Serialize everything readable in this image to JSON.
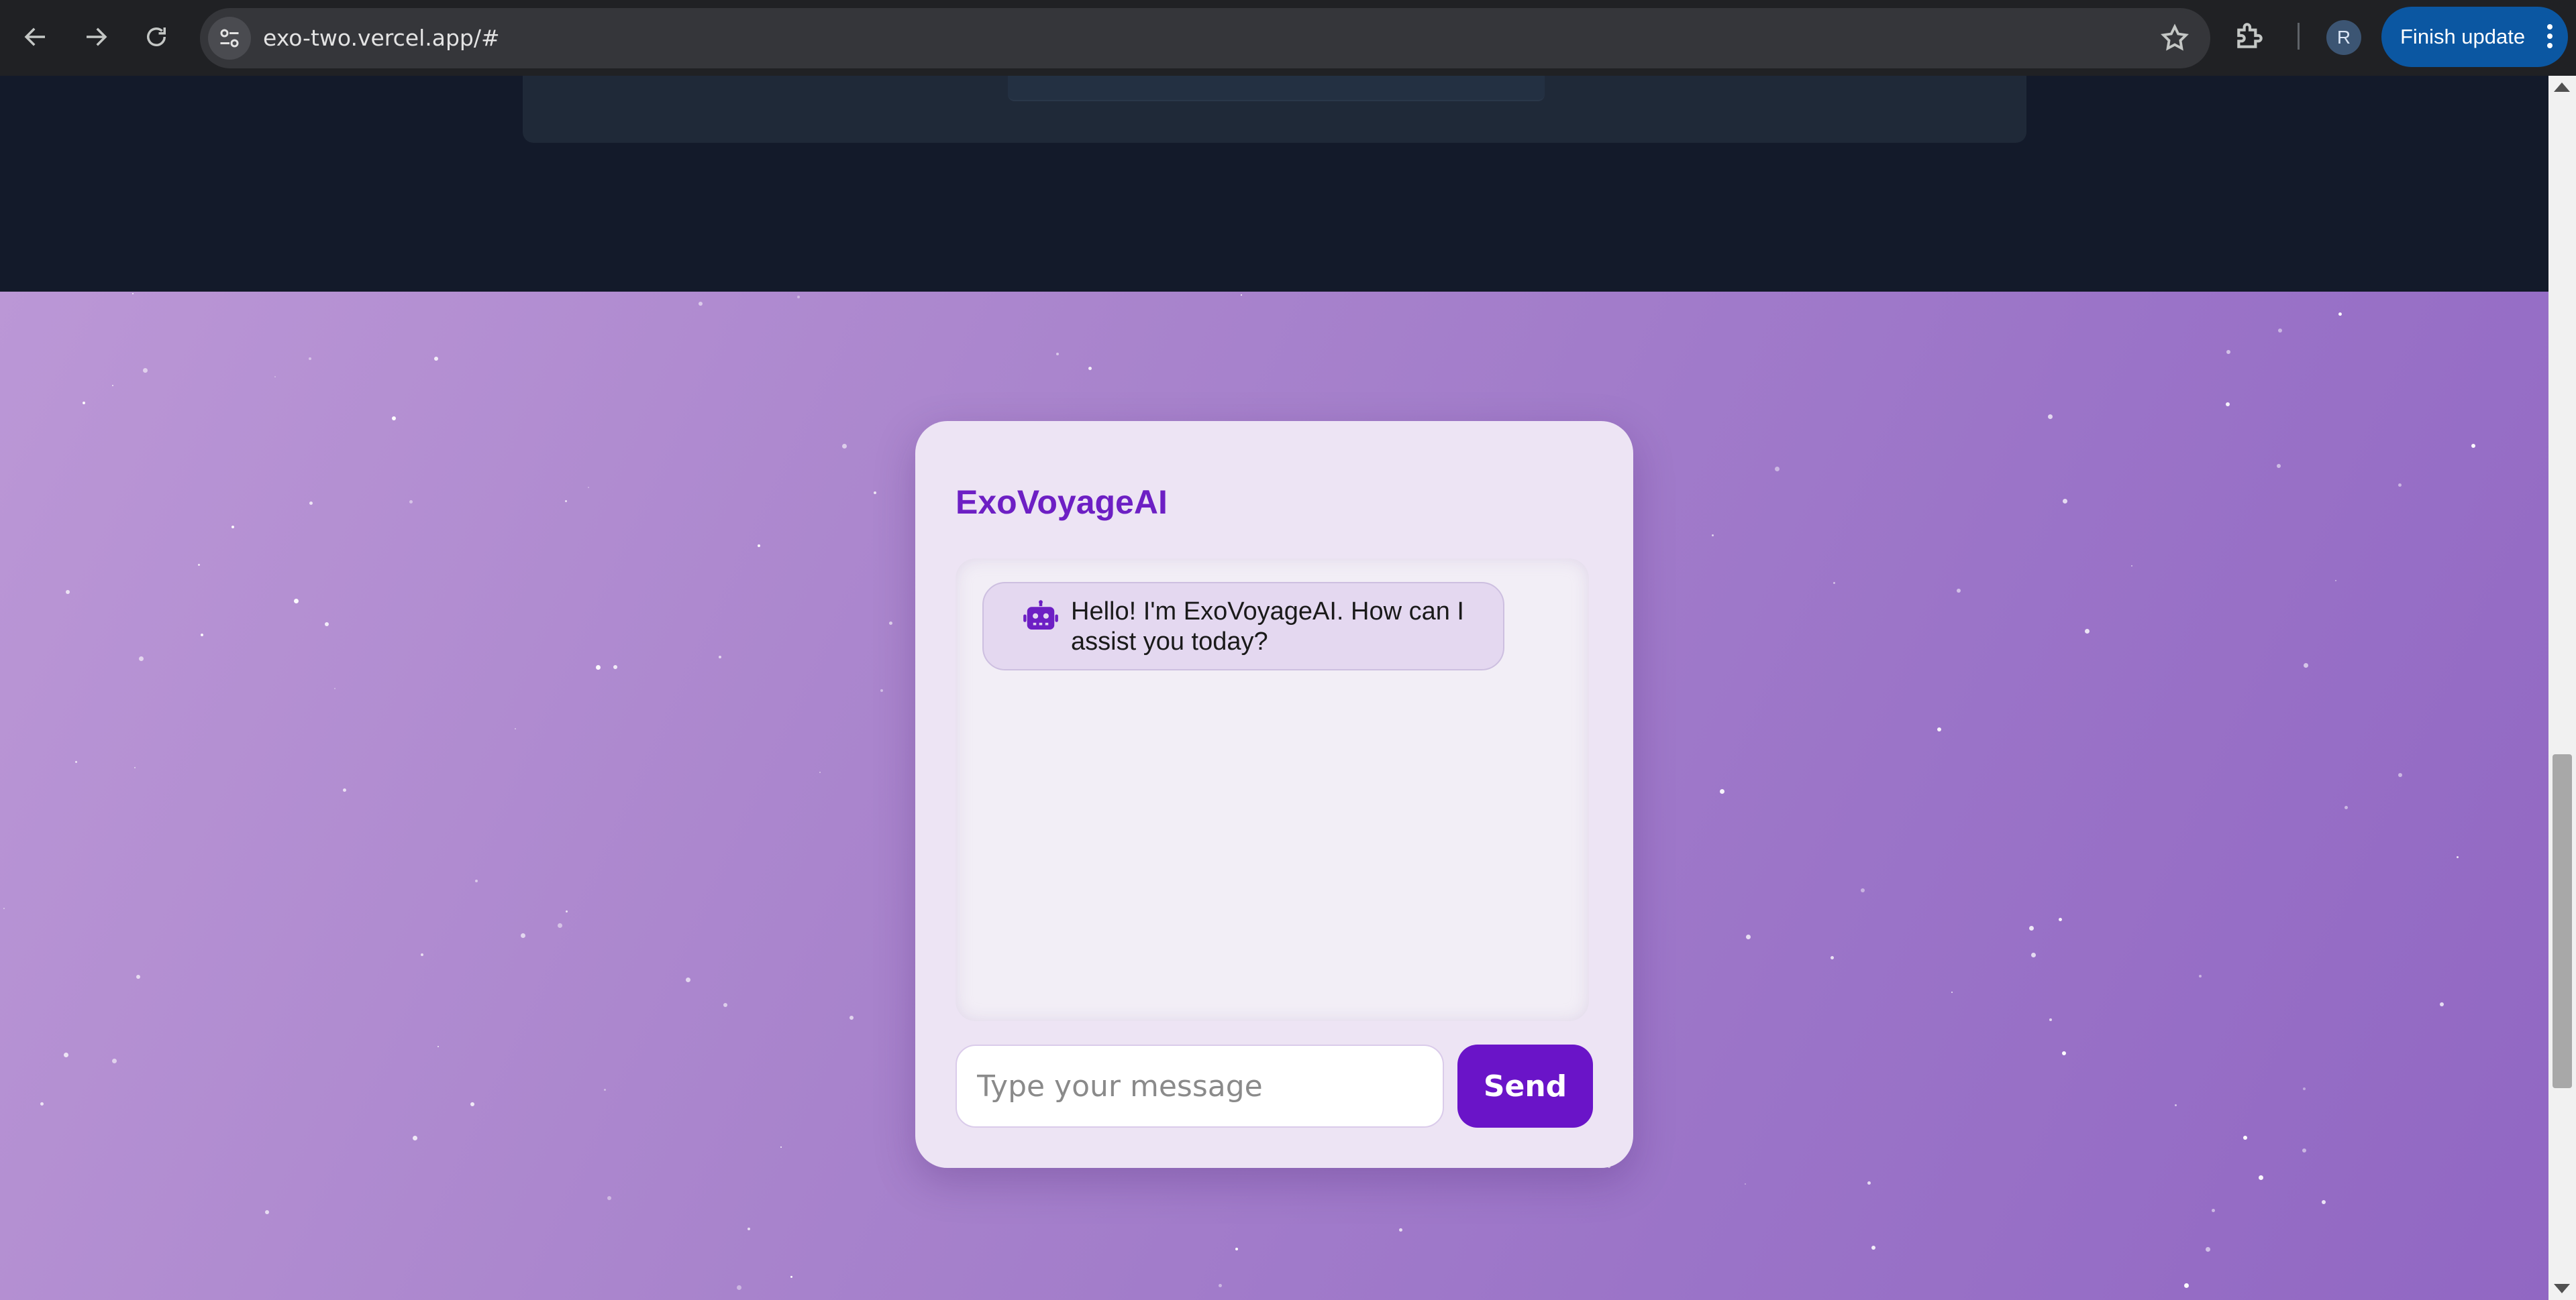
{
  "browser": {
    "url": "exo-two.vercel.app/#",
    "profile_initial": "R",
    "finish_update_label": "Finish update"
  },
  "chat": {
    "title": "ExoVoyageAI",
    "messages": [
      {
        "sender": "bot",
        "icon": "robot-icon",
        "text": "Hello! I'm ExoVoyageAI. How can I assist you today?"
      }
    ],
    "input": {
      "placeholder": "Type your message",
      "value": ""
    },
    "send_label": "Send"
  },
  "colors": {
    "accent": "#6a14c8",
    "title": "#6d1fc4",
    "dark_background": "#131a2a",
    "chrome": "#202124",
    "update_button": "#0b57a2"
  }
}
